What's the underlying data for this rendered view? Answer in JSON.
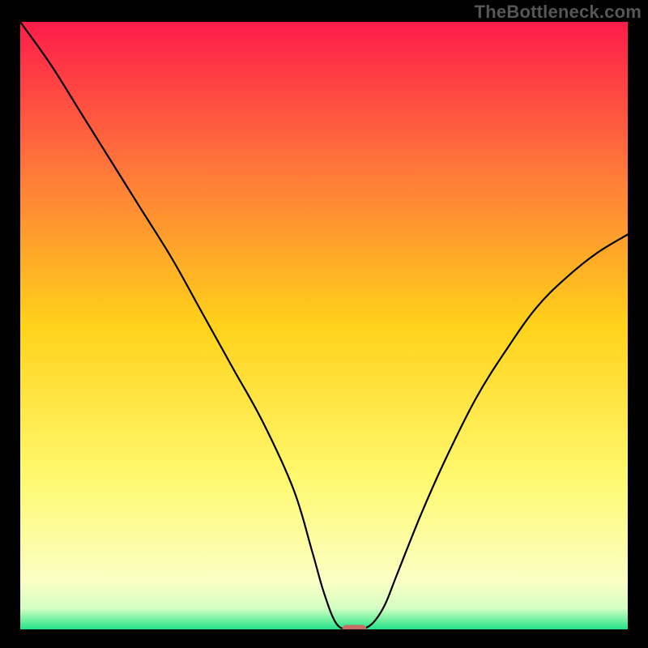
{
  "watermark": "TheBottleneck.com",
  "chart_data": {
    "type": "line",
    "title": "",
    "xlabel": "",
    "ylabel": "",
    "xlim": [
      0,
      100
    ],
    "ylim": [
      0,
      100
    ],
    "series": [
      {
        "name": "bottleneck-curve",
        "x": [
          0,
          5,
          10,
          15,
          20,
          25,
          30,
          35,
          40,
          45,
          48,
          50,
          52,
          54,
          56,
          58,
          60,
          62,
          66,
          70,
          75,
          80,
          85,
          90,
          95,
          100
        ],
        "y": [
          100,
          93,
          85,
          77,
          69,
          61,
          52,
          43,
          34,
          23,
          13,
          6,
          1,
          0,
          0,
          1,
          4,
          9,
          19,
          28,
          38,
          46,
          53,
          58,
          62,
          65
        ]
      }
    ],
    "marker": {
      "x_range": [
        53,
        57
      ],
      "y": 0,
      "color": "#c66d63"
    },
    "gradient_stops": [
      {
        "offset": 0,
        "color": "#ff1c4b"
      },
      {
        "offset": 0.25,
        "color": "#ff7a39"
      },
      {
        "offset": 0.5,
        "color": "#ffd21a"
      },
      {
        "offset": 0.75,
        "color": "#fff96f"
      },
      {
        "offset": 0.92,
        "color": "#fbffc4"
      },
      {
        "offset": 0.965,
        "color": "#d6ffc4"
      },
      {
        "offset": 0.985,
        "color": "#6ff0a0"
      },
      {
        "offset": 1.0,
        "color": "#22e28a"
      }
    ]
  }
}
